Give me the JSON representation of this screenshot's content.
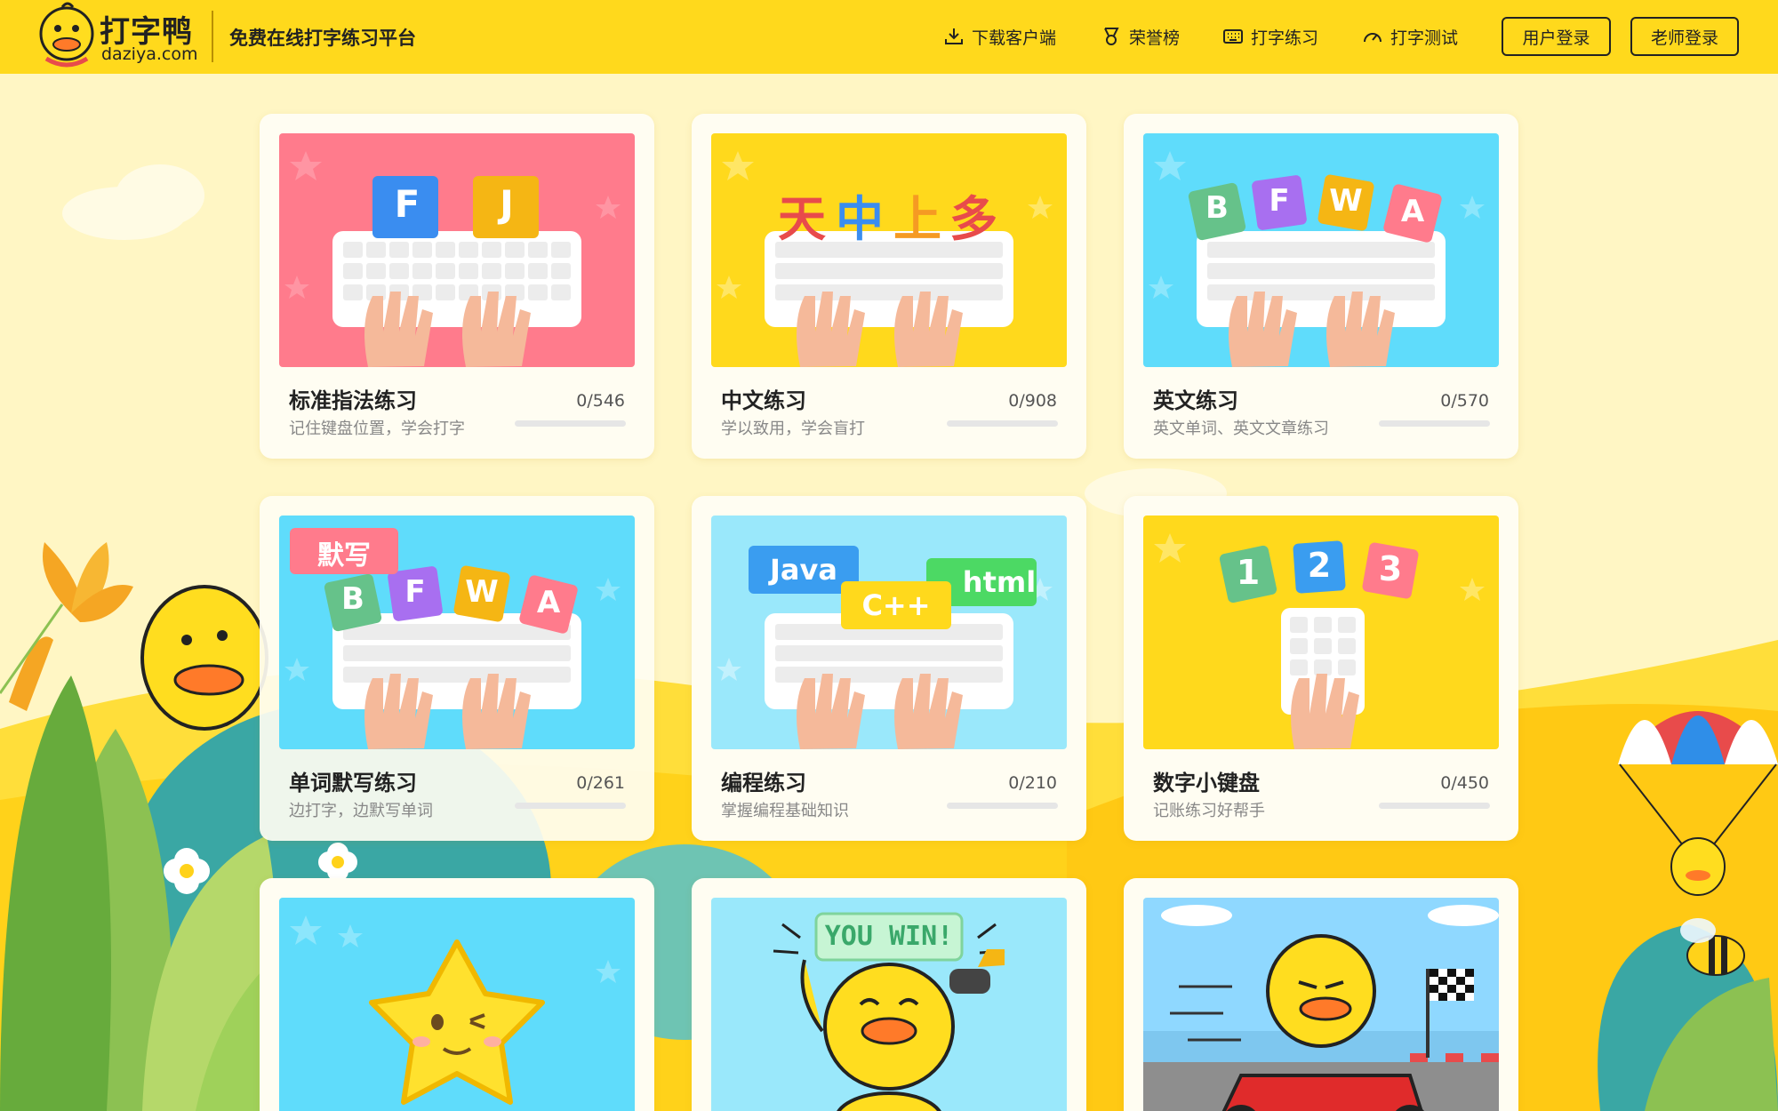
{
  "header": {
    "logo_cn": "打字鸭",
    "logo_en": "daziya.com",
    "slogan": "免费在线打字练习平台",
    "nav": [
      {
        "label": "下载客户端",
        "icon": "download-icon"
      },
      {
        "label": "荣誉榜",
        "icon": "medal-icon"
      },
      {
        "label": "打字练习",
        "icon": "keyboard-icon"
      },
      {
        "label": "打字测试",
        "icon": "speedometer-icon"
      }
    ],
    "user_login": "用户登录",
    "teacher_login": "老师登录"
  },
  "cards": [
    {
      "title": "标准指法练习",
      "desc": "记住键盘位置，学会打字",
      "count": "0/546",
      "progress": 0,
      "keys": [
        "F",
        "J"
      ]
    },
    {
      "title": "中文练习",
      "desc": "学以致用，学会盲打",
      "count": "0/908",
      "progress": 0,
      "keys": [
        "天",
        "中",
        "上",
        "多"
      ]
    },
    {
      "title": "英文练习",
      "desc": "英文单词、英文文章练习",
      "count": "0/570",
      "progress": 0,
      "keys": [
        "B",
        "F",
        "W",
        "A"
      ]
    },
    {
      "title": "单词默写练习",
      "desc": "边打字，边默写单词",
      "count": "0/261",
      "progress": 0,
      "keys": [
        "默写",
        "B",
        "F",
        "W",
        "A"
      ]
    },
    {
      "title": "编程练习",
      "desc": "掌握编程基础知识",
      "count": "0/210",
      "progress": 0,
      "keys": [
        "Java",
        "C++",
        "html"
      ]
    },
    {
      "title": "数字小键盘",
      "desc": "记账练习好帮手",
      "count": "0/450",
      "progress": 0,
      "keys": [
        "1",
        "2",
        "3"
      ]
    },
    {
      "title": "",
      "desc": "",
      "count": "",
      "progress": 0,
      "keys": []
    },
    {
      "title": "",
      "desc": "",
      "count": "",
      "progress": 0,
      "keys": [
        "YOU WIN!"
      ]
    },
    {
      "title": "",
      "desc": "",
      "count": "",
      "progress": 0,
      "keys": []
    }
  ],
  "colors": {
    "header_bg": "#ffd91c",
    "page_bg": "#fff6c4",
    "card_pink": "#ff7b8c",
    "card_yellow": "#ffd91c",
    "card_blue": "#5fdcfb",
    "card_lightblue": "#9ae8fb"
  }
}
